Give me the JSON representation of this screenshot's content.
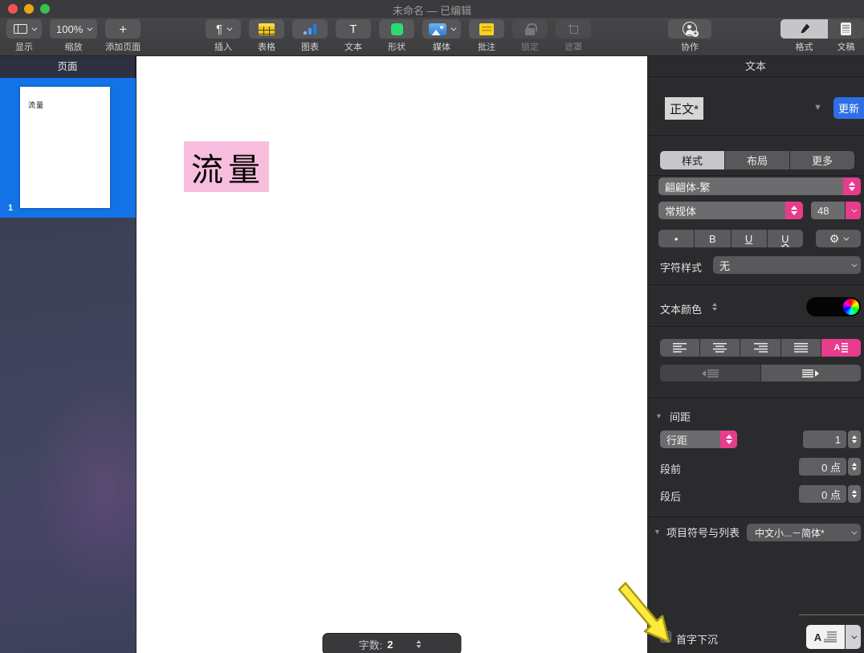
{
  "window": {
    "title": "未命名 — 已编辑"
  },
  "glyphs": {
    "pilcrow": "¶",
    "plus": "+",
    "tee": "T",
    "bold": "B",
    "underline": "U",
    "dot": "•",
    "gear": "⚙",
    "tri_down": "▼",
    "a": "A"
  },
  "toolbar": {
    "view": {
      "label": "显示"
    },
    "zoom": {
      "label": "缩放",
      "value": "100%"
    },
    "add_page": {
      "label": "添加页面"
    },
    "insert": {
      "label": "插入"
    },
    "table": {
      "label": "表格"
    },
    "chart": {
      "label": "图表"
    },
    "text": {
      "label": "文本"
    },
    "shape": {
      "label": "形状"
    },
    "media": {
      "label": "媒体"
    },
    "comment": {
      "label": "批注"
    },
    "lock": {
      "label": "锁定"
    },
    "mask": {
      "label": "遮罩"
    },
    "collaborate": {
      "label": "协作"
    },
    "format": {
      "label": "格式"
    },
    "document": {
      "label": "文稿"
    }
  },
  "sidebar": {
    "header": "页面",
    "page_number": "1",
    "thumbnail_text": "流量"
  },
  "canvas": {
    "selected_text": "流量",
    "word_count_label": "字数:",
    "word_count_value": "2"
  },
  "inspector": {
    "header": "文本",
    "paragraph_style": "正文*",
    "update_button": "更新",
    "tabs": {
      "style": "样式",
      "layout": "布局",
      "more": "更多"
    },
    "font_family": "翩翩体-繁",
    "font_style": "常规体",
    "font_size": "48",
    "char_style_label": "字符样式",
    "char_style_value": "无",
    "text_color_label": "文本颜色",
    "spacing_header": "间距",
    "line_spacing_label": "行距",
    "line_spacing_value": "1",
    "para_before_label": "段前",
    "para_before_value": "0 点",
    "para_after_label": "段后",
    "para_after_value": "0 点",
    "bullets_header": "项目符号与列表",
    "bullets_value": "中文小...－简体*",
    "dropcap_label": "首字下沉"
  },
  "colors": {
    "accent_pink": "#e63c8c",
    "accent_blue": "#2e6fe5",
    "selection_blue": "#1273e6",
    "highlight_pink": "#f6bddc",
    "traffic_red": "#f0564f",
    "traffic_yellow": "#e8a711",
    "traffic_green": "#37c24e"
  }
}
